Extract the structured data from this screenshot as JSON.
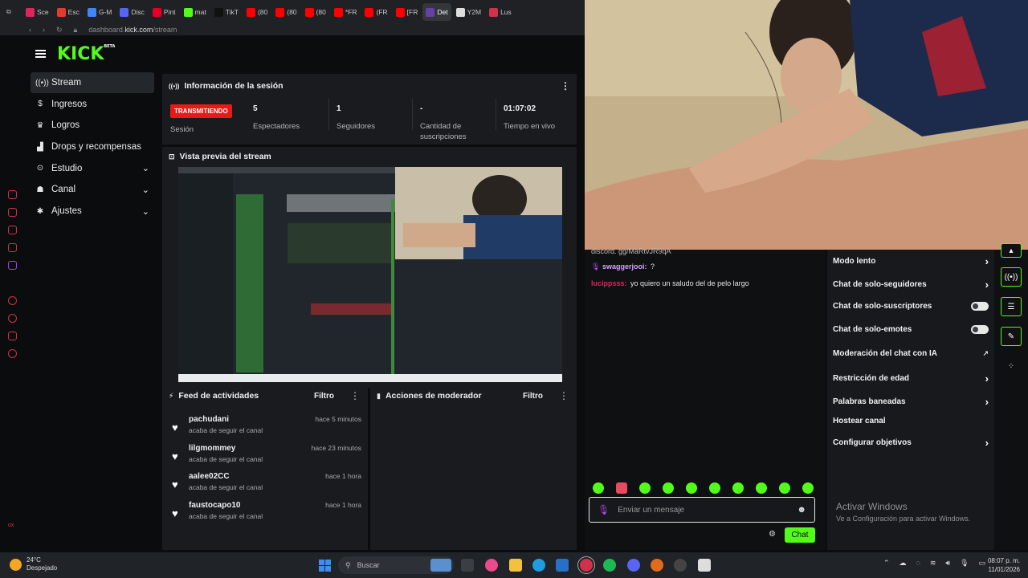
{
  "browser": {
    "tabs": [
      {
        "label": "Sce",
        "color": "#e0245e"
      },
      {
        "label": "Esc",
        "color": "#e03c2e"
      },
      {
        "label": "G-M",
        "color": "#4285f4"
      },
      {
        "label": "Disc",
        "color": "#5865f2"
      },
      {
        "label": "Pint",
        "color": "#e60023"
      },
      {
        "label": "mat",
        "color": "#53fc18"
      },
      {
        "label": "TikT",
        "color": "#111111"
      },
      {
        "label": "(80",
        "color": "#ff0000"
      },
      {
        "label": "(80",
        "color": "#ff0000"
      },
      {
        "label": "(80",
        "color": "#ff0000"
      },
      {
        "label": "*FR",
        "color": "#ff0000"
      },
      {
        "label": "(FR",
        "color": "#ff0000"
      },
      {
        "label": "[FR",
        "color": "#ff0000"
      },
      {
        "label": "Det",
        "color": "#6441a5"
      },
      {
        "label": "Y2M",
        "color": "#dddddd"
      },
      {
        "label": "Lus",
        "color": "#d0314b"
      }
    ],
    "active_tab": 13,
    "url_host": "dashboard.",
    "url_domain": "kick.com",
    "url_path": "/stream"
  },
  "brand": {
    "logo": "KICK",
    "beta": "BETA",
    "accent": "#53fc18"
  },
  "sidebar": {
    "items": [
      {
        "label": "Stream",
        "icon": "broadcast-icon",
        "glyph": "((•))",
        "active": true,
        "expand": false
      },
      {
        "label": "Ingresos",
        "icon": "dollar-icon",
        "glyph": "$",
        "active": false,
        "expand": false
      },
      {
        "label": "Logros",
        "icon": "trophy-icon",
        "glyph": "♛",
        "active": false,
        "expand": false
      },
      {
        "label": "Drops y recompensas",
        "icon": "gift-icon",
        "glyph": "▟",
        "active": false,
        "expand": false
      },
      {
        "label": "Estudio",
        "icon": "studio-icon",
        "glyph": "⊙",
        "active": false,
        "expand": true
      },
      {
        "label": "Canal",
        "icon": "channel-icon",
        "glyph": "☗",
        "active": false,
        "expand": true
      },
      {
        "label": "Ajustes",
        "icon": "gear-icon",
        "glyph": "✱",
        "active": false,
        "expand": true
      }
    ]
  },
  "session": {
    "title": "Información de la sesión",
    "status_badge": "TRANSMITIENDO",
    "status_label": "Sesión",
    "viewers_value": "5",
    "viewers_label": "Espectadores",
    "followers_value": "1",
    "followers_label": "Seguidores",
    "subs_value": "-",
    "subs_label": "Cantidad de suscripciones",
    "uptime_value": "01:07:02",
    "uptime_label": "Tiempo en vivo"
  },
  "preview": {
    "title": "Vista previa del stream"
  },
  "activity_feed": {
    "title": "Feed de actividades",
    "filter": "Filtro",
    "items": [
      {
        "user": "pachudani",
        "action": "acaba de seguir el canal",
        "time": "hace 5 minutos"
      },
      {
        "user": "lilgmommey",
        "action": "acaba de seguir el canal",
        "time": "hace 23 minutos"
      },
      {
        "user": "aalee02CC",
        "action": "acaba de seguir el canal",
        "time": "hace 1 hora"
      },
      {
        "user": "faustocapo10",
        "action": "acaba de seguir el canal",
        "time": "hace 1 hora"
      }
    ]
  },
  "mod_actions": {
    "title": "Acciones de moderador",
    "filter": "Filtro"
  },
  "chat": {
    "partial_line": "discord. gg/MaRtvJR9qA",
    "messages": [
      {
        "user": "swaggerjooi:",
        "text": "?",
        "color": "#d6a3ff",
        "badge": true
      },
      {
        "user": "lucippsss:",
        "text": "yo quiero un saludo del de pelo largo",
        "color": "#e0245e",
        "badge": false
      }
    ],
    "input_placeholder": "Enviar un mensaje",
    "send_label": "Chat"
  },
  "mod_settings": {
    "items": [
      {
        "label": "Modo lento",
        "control": "chevron"
      },
      {
        "label": "Chat de solo-seguidores",
        "control": "chevron"
      },
      {
        "label": "Chat de solo-suscriptores",
        "control": "toggle",
        "on": false
      },
      {
        "label": "Chat de solo-emotes",
        "control": "toggle",
        "on": false
      },
      {
        "label": "Moderación del chat con IA",
        "control": "external"
      },
      {
        "label": "Restricción de edad",
        "control": "chevron"
      },
      {
        "label": "Palabras baneadas",
        "control": "chevron"
      },
      {
        "label": "Hostear canal",
        "control": "none"
      },
      {
        "label": "Configurar objetivos",
        "control": "chevron"
      }
    ]
  },
  "watermark": {
    "title": "Activar Windows",
    "subtitle": "Ve a Configuración para activar Windows."
  },
  "taskbar": {
    "temp": "24°C",
    "weather": "Despejado",
    "search_placeholder": "Buscar",
    "time": "08:07 p. m.",
    "date": "11/01/2026"
  }
}
